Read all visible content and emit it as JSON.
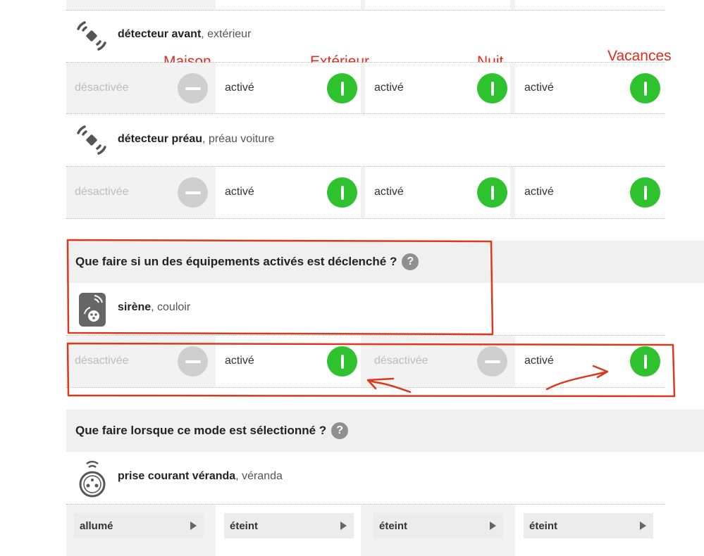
{
  "modes": {
    "maison": "Maison",
    "exterieur": "Extérieur",
    "nuit": "Nuit",
    "vacances": "Vacances"
  },
  "states": {
    "desactivee": "désactivée",
    "active": "activé"
  },
  "devices": {
    "avant": {
      "name": "détecteur avant",
      "location": ", extérieur"
    },
    "preau": {
      "name": "détecteur préau",
      "location": ", préau voiture"
    },
    "sirene": {
      "name": "sirène",
      "location": ", couloir"
    },
    "prise": {
      "name": "prise courant véranda",
      "location": ", véranda"
    }
  },
  "sections": {
    "triggered": {
      "title": "Que faire si un des équipements activés est déclenché ?"
    },
    "selected": {
      "title": "Que faire lorsque ce mode est sélectionné ?"
    },
    "help": "?"
  },
  "plug": {
    "options": [
      "allumé",
      "éteint",
      "éteint",
      "éteint"
    ]
  },
  "colors": {
    "active_green": "#2ec32e",
    "inactive_gray": "#cfcfcf",
    "annotation_red": "#e02b20"
  }
}
